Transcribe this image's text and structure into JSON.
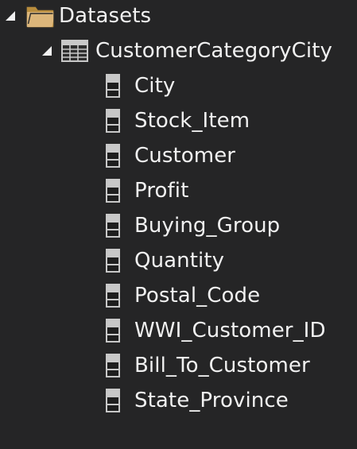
{
  "tree": {
    "root": {
      "label": "Datasets",
      "icon": "folder-icon",
      "expanded": true
    },
    "dataset": {
      "label": "CustomerCategoryCity",
      "icon": "table-icon",
      "expanded": true,
      "fields": [
        {
          "label": "City",
          "icon": "field-icon"
        },
        {
          "label": "Stock_Item",
          "icon": "field-icon"
        },
        {
          "label": "Customer",
          "icon": "field-icon"
        },
        {
          "label": "Profit",
          "icon": "field-icon"
        },
        {
          "label": "Buying_Group",
          "icon": "field-icon"
        },
        {
          "label": "Quantity",
          "icon": "field-icon"
        },
        {
          "label": "Postal_Code",
          "icon": "field-icon"
        },
        {
          "label": "WWI_Customer_ID",
          "icon": "field-icon"
        },
        {
          "label": "Bill_To_Customer",
          "icon": "field-icon"
        },
        {
          "label": "State_Province",
          "icon": "field-icon"
        }
      ]
    }
  },
  "colors": {
    "background": "#252526",
    "text": "#f1f1f1",
    "folder": "#dcb67a",
    "icon_gray": "#c8c8c8"
  }
}
